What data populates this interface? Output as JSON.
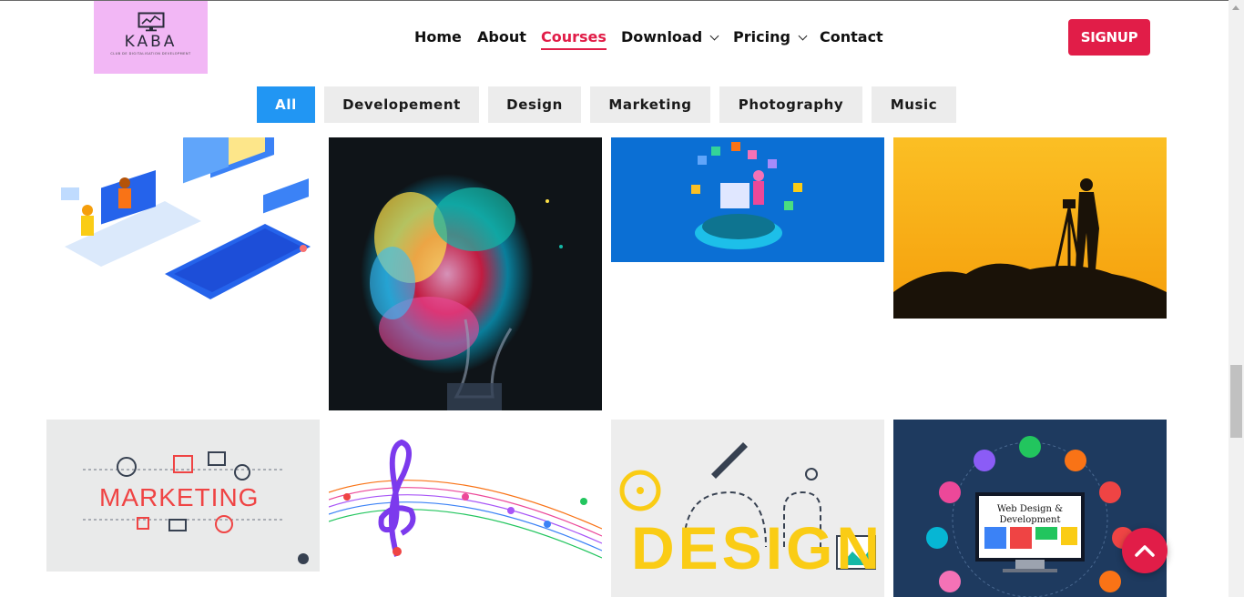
{
  "logo": {
    "brand": "KABA",
    "tagline": "CLUB DE DIGITALISATION DEVELOPMENT"
  },
  "nav": {
    "items": [
      {
        "label": "Home",
        "active": false
      },
      {
        "label": "About",
        "active": false
      },
      {
        "label": "Courses",
        "active": true
      },
      {
        "label": "Download",
        "dropdown": true
      },
      {
        "label": "Pricing",
        "dropdown": true
      },
      {
        "label": "Contact",
        "active": false
      }
    ],
    "signup": "SIGNUP"
  },
  "filters": [
    "All",
    "Developement",
    "Design",
    "Marketing",
    "Photography",
    "Music"
  ],
  "active_filter": "All",
  "gallery": {
    "tiles": [
      {
        "name": "development-illustration"
      },
      {
        "name": "creative-lightbulb"
      },
      {
        "name": "web-developer-isometric"
      },
      {
        "name": "photographer-silhouette"
      },
      {
        "name": "marketing-banner",
        "text": "MARKETING"
      },
      {
        "name": "music-notes"
      },
      {
        "name": "design-banner",
        "text": "DESIGN"
      },
      {
        "name": "web-design-development",
        "text_line1": "Web Design &",
        "text_line2": "Development"
      }
    ]
  },
  "colors": {
    "accent": "#e11d48",
    "filter_active": "#2196f3",
    "logo_bg": "#f2b7f5"
  },
  "icons": {
    "back_to_top": "chevron-up-icon",
    "dropdown": "chevron-down-icon"
  }
}
